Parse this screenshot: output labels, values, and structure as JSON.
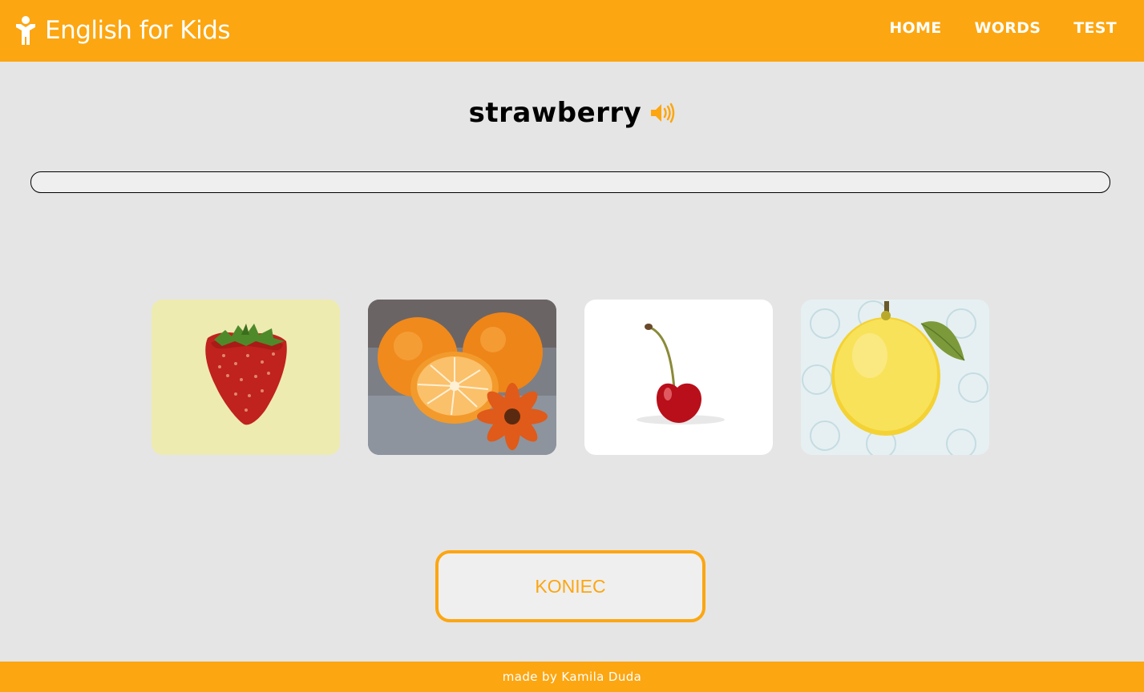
{
  "header": {
    "brand": "English for Kids",
    "nav": [
      "HOME",
      "WORDS",
      "TEST"
    ]
  },
  "quiz": {
    "word": "strawberry",
    "progress": 0,
    "choices": [
      {
        "icon": "strawberry-image"
      },
      {
        "icon": "orange-image"
      },
      {
        "icon": "cherry-image"
      },
      {
        "icon": "lemon-image"
      }
    ],
    "end_label": "KONIEC"
  },
  "footer": {
    "text": "made by Kamila Duda"
  },
  "colors": {
    "accent": "#fca611",
    "background": "#e5e5e5"
  }
}
